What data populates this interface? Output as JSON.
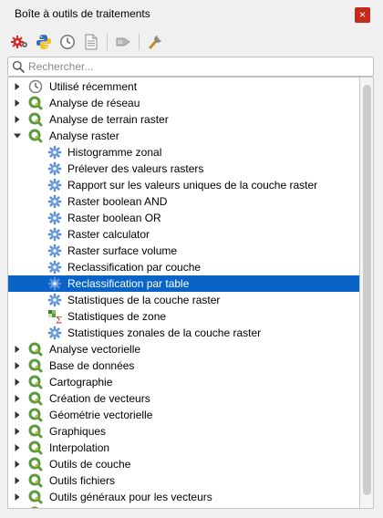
{
  "window": {
    "title": "Boîte à outils de traitements",
    "close_glyph": "×"
  },
  "toolbar": {
    "buttons": [
      {
        "icon": "gears-models-icon"
      },
      {
        "icon": "python-icon"
      },
      {
        "icon": "history-clock-icon"
      },
      {
        "icon": "results-document-icon"
      },
      {
        "icon": "edit-in-place-icon"
      },
      {
        "icon": "options-wrench-icon"
      }
    ]
  },
  "search": {
    "placeholder": "Rechercher..."
  },
  "tree": {
    "items": [
      {
        "label": "Utilisé récemment",
        "level": 0,
        "arrow": "collapsed",
        "icon": "clock-icon"
      },
      {
        "label": "Analyse de réseau",
        "level": 0,
        "arrow": "collapsed",
        "icon": "qgis-icon"
      },
      {
        "label": "Analyse de terrain raster",
        "level": 0,
        "arrow": "collapsed",
        "icon": "qgis-icon"
      },
      {
        "label": "Analyse raster",
        "level": 0,
        "arrow": "expanded",
        "icon": "qgis-icon"
      },
      {
        "label": "Histogramme zonal",
        "level": 1,
        "icon": "gear-icon"
      },
      {
        "label": "Prélever des valeurs rasters",
        "level": 1,
        "icon": "gear-icon"
      },
      {
        "label": "Rapport sur les valeurs uniques de la couche raster",
        "level": 1,
        "icon": "gear-icon"
      },
      {
        "label": "Raster boolean AND",
        "level": 1,
        "icon": "gear-icon"
      },
      {
        "label": "Raster boolean OR",
        "level": 1,
        "icon": "gear-icon"
      },
      {
        "label": "Raster calculator",
        "level": 1,
        "icon": "gear-icon"
      },
      {
        "label": "Raster surface volume",
        "level": 1,
        "icon": "gear-icon"
      },
      {
        "label": "Reclassification par couche",
        "level": 1,
        "icon": "gear-icon"
      },
      {
        "label": "Reclassification par table",
        "level": 1,
        "icon": "gear-icon",
        "selected": true
      },
      {
        "label": "Statistiques de la couche raster",
        "level": 1,
        "icon": "gear-icon"
      },
      {
        "label": "Statistiques de zone",
        "level": 1,
        "icon": "zonal-stats-icon"
      },
      {
        "label": "Statistiques zonales de la couche raster",
        "level": 1,
        "icon": "gear-icon"
      },
      {
        "label": "Analyse vectorielle",
        "level": 0,
        "arrow": "collapsed",
        "icon": "qgis-icon"
      },
      {
        "label": "Base de données",
        "level": 0,
        "arrow": "collapsed",
        "icon": "qgis-icon"
      },
      {
        "label": "Cartographie",
        "level": 0,
        "arrow": "collapsed",
        "icon": "qgis-icon"
      },
      {
        "label": "Création de vecteurs",
        "level": 0,
        "arrow": "collapsed",
        "icon": "qgis-icon"
      },
      {
        "label": "Géométrie vectorielle",
        "level": 0,
        "arrow": "collapsed",
        "icon": "qgis-icon"
      },
      {
        "label": "Graphiques",
        "level": 0,
        "arrow": "collapsed",
        "icon": "qgis-icon"
      },
      {
        "label": "Interpolation",
        "level": 0,
        "arrow": "collapsed",
        "icon": "qgis-icon"
      },
      {
        "label": "Outils de couche",
        "level": 0,
        "arrow": "collapsed",
        "icon": "qgis-icon"
      },
      {
        "label": "Outils fichiers",
        "level": 0,
        "arrow": "collapsed",
        "icon": "qgis-icon"
      },
      {
        "label": "Outils généraux pour les vecteurs",
        "level": 0,
        "arrow": "collapsed",
        "icon": "qgis-icon"
      },
      {
        "label": "",
        "level": 0,
        "arrow": "collapsed",
        "icon": "qgis-icon"
      }
    ]
  },
  "colors": {
    "selection": "#0a64c8",
    "qgis_green": "#5b9a3c",
    "gear_blue": "#5a8fd6",
    "close_red": "#c42b1c"
  }
}
